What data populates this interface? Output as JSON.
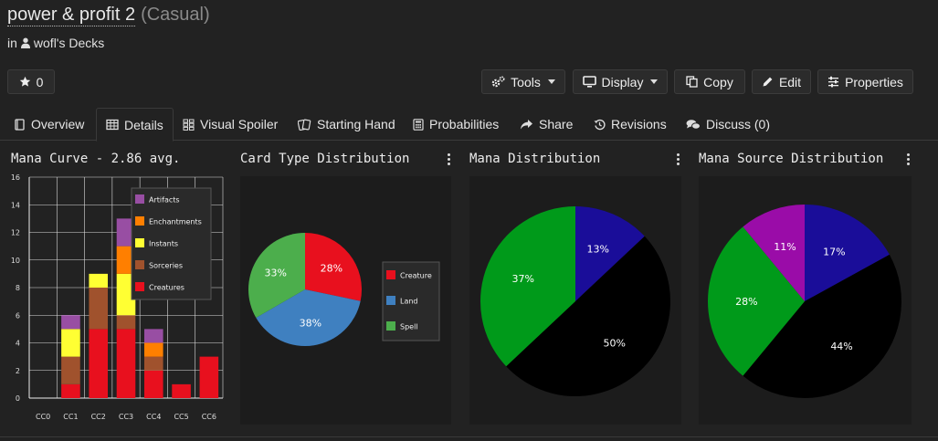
{
  "header": {
    "deck_title": "power & profit 2",
    "deck_format": "(Casual)",
    "owner_prefix": "in",
    "owner_label": "wofl's Decks"
  },
  "toolbar": {
    "star_count": "0",
    "tools_label": "Tools",
    "display_label": "Display",
    "copy_label": "Copy",
    "edit_label": "Edit",
    "properties_label": "Properties"
  },
  "tabs": [
    {
      "label": "Overview",
      "icon": "book-icon",
      "active": false
    },
    {
      "label": "Details",
      "icon": "table-icon",
      "active": true
    },
    {
      "label": "Visual Spoiler",
      "icon": "grid-icon",
      "active": false
    },
    {
      "label": "Starting Hand",
      "icon": "cards-icon",
      "active": false
    },
    {
      "label": "Probabilities",
      "icon": "calculator-icon",
      "active": false
    },
    {
      "label": "Share",
      "icon": "share-icon",
      "active": false
    },
    {
      "label": "Revisions",
      "icon": "history-icon",
      "active": false
    },
    {
      "label": "Discuss (0)",
      "icon": "comments-icon",
      "active": false
    }
  ],
  "panels": {
    "mana_curve_title": "Mana Curve - 2.86 avg.",
    "card_type_title": "Card Type Distribution",
    "mana_dist_title": "Mana Distribution",
    "mana_source_title": "Mana Source Distribution"
  },
  "chart_data": [
    {
      "type": "bar",
      "stacked": true,
      "title": "Mana Curve - 2.86 avg.",
      "categories": [
        "CC0",
        "CC1",
        "CC2",
        "CC3",
        "CC4",
        "CC5",
        "CC6"
      ],
      "ylim": [
        0,
        16
      ],
      "yticks": [
        0,
        2,
        4,
        6,
        8,
        10,
        12,
        14,
        16
      ],
      "grid": true,
      "legend": "top-right",
      "series": [
        {
          "name": "Creatures",
          "color": "#e8101e",
          "values": [
            0,
            1,
            5,
            5,
            2,
            1,
            3
          ]
        },
        {
          "name": "Sorceries",
          "color": "#a0522d",
          "values": [
            0,
            2,
            3,
            1,
            1,
            0,
            0
          ]
        },
        {
          "name": "Instants",
          "color": "#ffff33",
          "values": [
            0,
            2,
            1,
            3,
            0,
            0,
            0
          ]
        },
        {
          "name": "Enchantments",
          "color": "#ff7f00",
          "values": [
            0,
            0,
            0,
            2,
            1,
            0,
            0
          ]
        },
        {
          "name": "Artifacts",
          "color": "#984ea3",
          "values": [
            0,
            1,
            0,
            2,
            1,
            0,
            0
          ]
        }
      ]
    },
    {
      "type": "pie",
      "title": "Card Type Distribution",
      "legend": "right",
      "slices": [
        {
          "label": "Creature",
          "value": 28,
          "color": "#e8101e"
        },
        {
          "label": "Land",
          "value": 38,
          "color": "#3f80c0"
        },
        {
          "label": "Spell",
          "value": 33,
          "color": "#4cae4c"
        }
      ]
    },
    {
      "type": "pie",
      "title": "Mana Distribution",
      "slices": [
        {
          "label": "",
          "value": 13,
          "color": "#1a0d99"
        },
        {
          "label": "",
          "value": 50,
          "color": "#000000"
        },
        {
          "label": "",
          "value": 37,
          "color": "#009a1a"
        }
      ]
    },
    {
      "type": "pie",
      "title": "Mana Source Distribution",
      "slices": [
        {
          "label": "",
          "value": 17,
          "color": "#1a0d99"
        },
        {
          "label": "",
          "value": 44,
          "color": "#000000"
        },
        {
          "label": "",
          "value": 28,
          "color": "#009a1a"
        },
        {
          "label": "",
          "value": 11,
          "color": "#9a0ca8"
        }
      ]
    }
  ]
}
